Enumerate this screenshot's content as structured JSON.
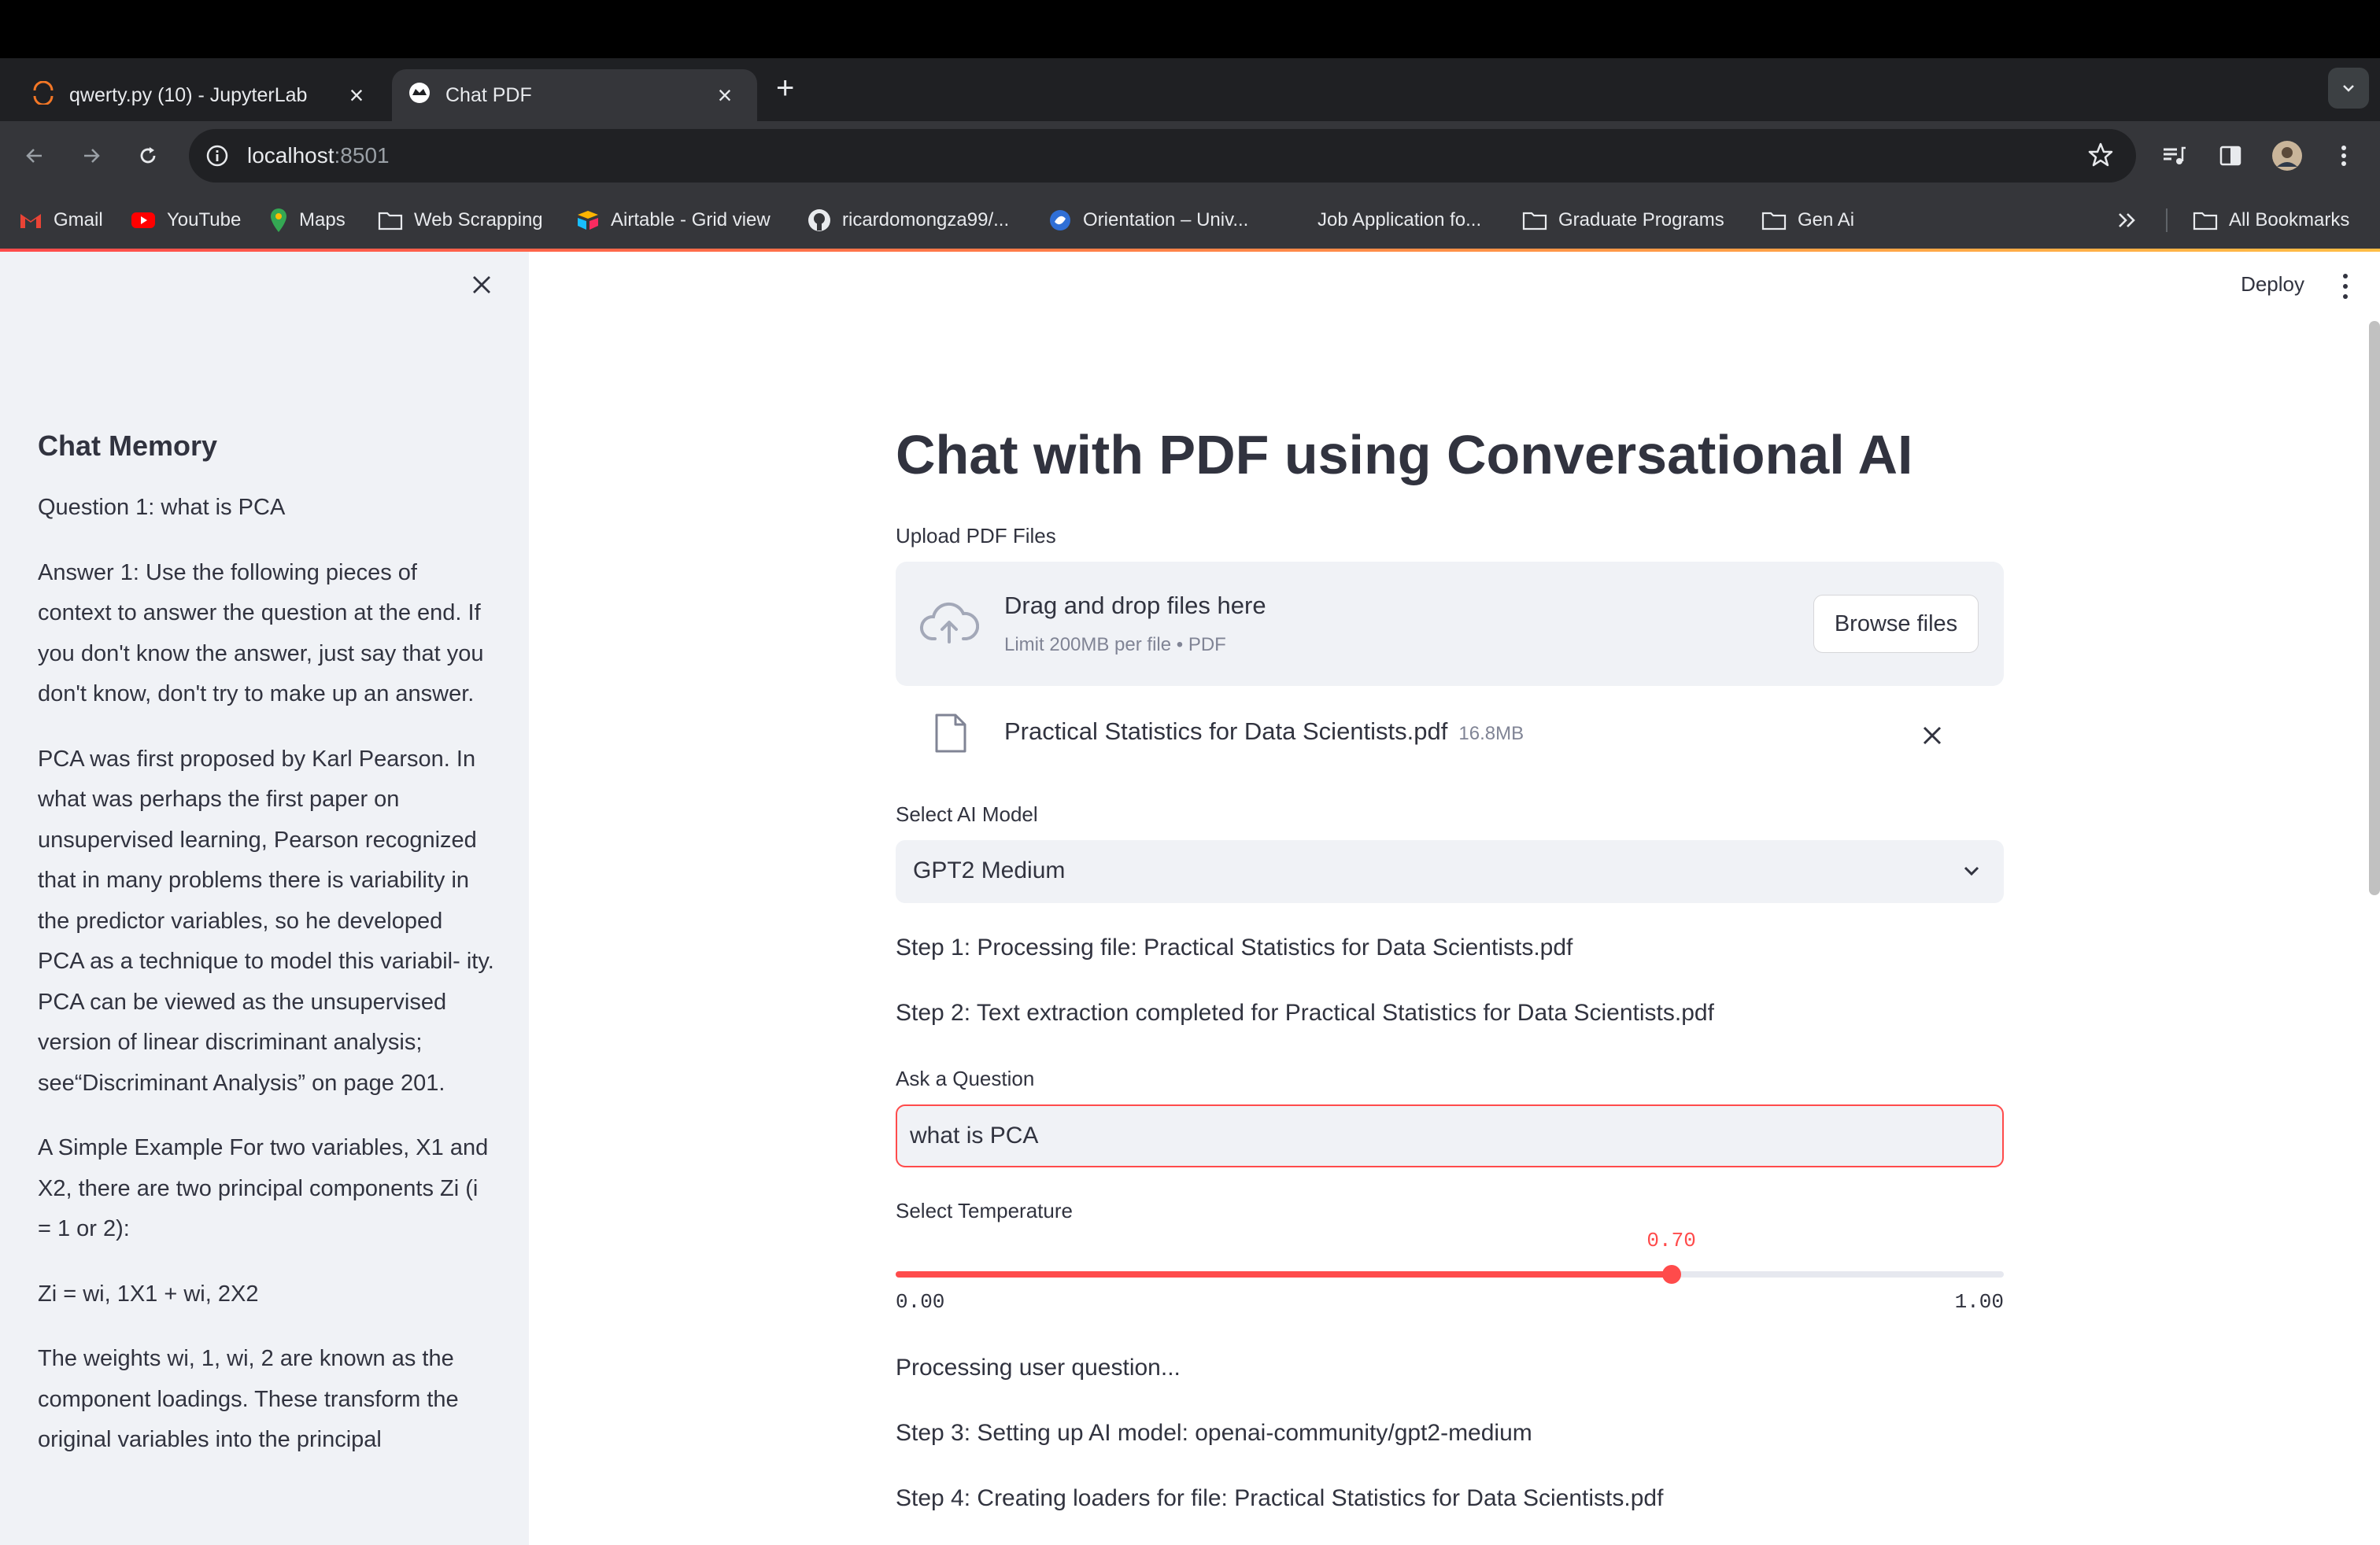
{
  "browser": {
    "tabs": [
      {
        "title": "qwerty.py (10) - JupyterLab",
        "active": false
      },
      {
        "title": "Chat PDF",
        "active": true
      }
    ],
    "url_host": "localhost",
    "url_port": ":8501",
    "bookmarks": [
      {
        "label": "Gmail",
        "icon": "gmail-icon"
      },
      {
        "label": "YouTube",
        "icon": "youtube-icon"
      },
      {
        "label": "Maps",
        "icon": "maps-icon"
      },
      {
        "label": "Web Scrapping",
        "icon": "folder-icon"
      },
      {
        "label": "Airtable - Grid view",
        "icon": "airtable-icon"
      },
      {
        "label": "ricardomongza99/...",
        "icon": "github-icon"
      },
      {
        "label": "Orientation – Univ...",
        "icon": "orientation-icon"
      },
      {
        "label": "Job Application fo...",
        "icon": "blank-icon"
      },
      {
        "label": "Graduate Programs",
        "icon": "folder-icon"
      },
      {
        "label": "Gen Ai",
        "icon": "folder-icon"
      }
    ],
    "all_bookmarks": "All Bookmarks"
  },
  "sidebar": {
    "heading": "Chat Memory",
    "paragraphs": [
      "Question 1: what is PCA",
      "Answer 1: Use the following pieces of context to answer the question at the end. If you don't know the answer, just say that you don't know, don't try to make up an answer.",
      "PCA was first proposed by Karl Pearson. In what was perhaps the first paper on unsupervised learning, Pearson recognized that in many problems there is variability in the predictor variables, so he developed PCA as a technique to model this variabil- ity. PCA can be viewed as the unsupervised version of linear discriminant analysis; see“Discriminant Analysis” on page 201.",
      "A Simple Example For two variables, X1 and X2, there are two principal components Zi (i = 1 or 2):",
      "Zi = wi, 1X1 + wi, 2X2",
      "The weights wi, 1, wi, 2 are known as the component loadings. These transform the original variables into the principal"
    ]
  },
  "main": {
    "deploy_label": "Deploy",
    "title": "Chat with PDF using Conversational AI",
    "upload_label": "Upload PDF Files",
    "dropzone_main": "Drag and drop files here",
    "dropzone_sub": "Limit 200MB per file • PDF",
    "browse_label": "Browse files",
    "file_name": "Practical Statistics for Data Scientists.pdf",
    "file_size": "16.8MB",
    "model_label": "Select AI Model",
    "model_value": "GPT2 Medium",
    "step1": "Step 1: Processing file: Practical Statistics for Data Scientists.pdf",
    "step2": "Step 2: Text extraction completed for Practical Statistics for Data Scientists.pdf",
    "question_label": "Ask a Question",
    "question_value": "what is PCA",
    "temperature_label": "Select Temperature",
    "temperature_value": "0.70",
    "temperature_fraction": 0.7,
    "temperature_min": "0.00",
    "temperature_max": "1.00",
    "processing": "Processing user question...",
    "step3": "Step 3: Setting up AI model: openai-community/gpt2-medium",
    "step4": "Step 4: Creating loaders for file: Practical Statistics for Data Scientists.pdf"
  },
  "colors": {
    "accent": "#ff4b4b",
    "sidebar_bg": "#f0f2f6",
    "text": "#31333f"
  }
}
